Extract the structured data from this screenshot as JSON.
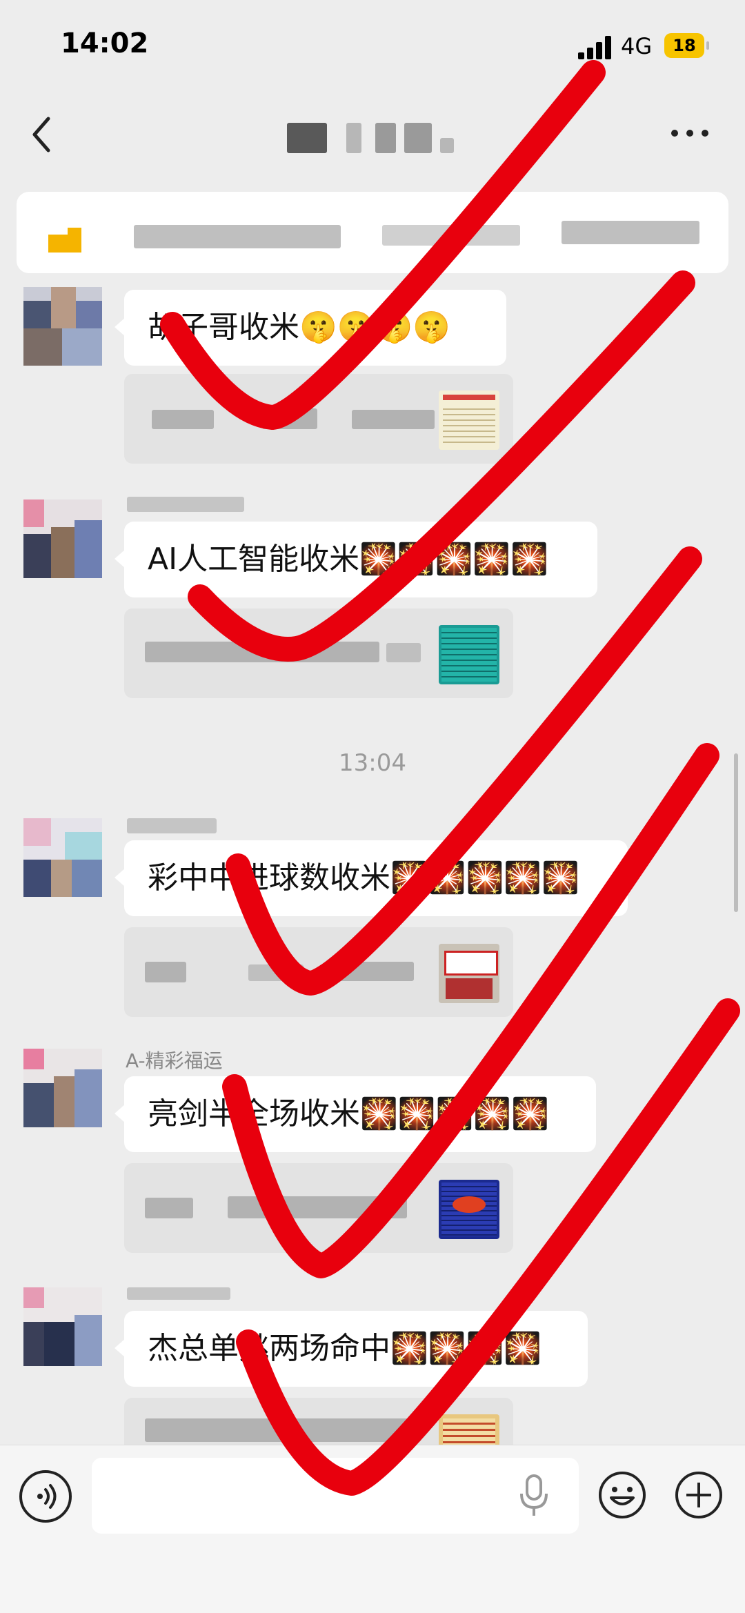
{
  "status_bar": {
    "time": "14:02",
    "network": "4G",
    "battery": "18"
  },
  "nav": {
    "title": "",
    "more_icon": "more-icon",
    "back_icon": "back-icon"
  },
  "messages": [
    {
      "sender": "",
      "text": "胡子哥收米🤫🤫🤫🤫",
      "quote": ""
    },
    {
      "sender": "",
      "text": "AI人工智能收米🎇🎇🎇🎇🎇",
      "quote": ""
    },
    {
      "sender": "",
      "text": "彩中中进球数收米🎇🎇🎇🎇🎇",
      "quote": ""
    },
    {
      "sender": "A-精彩福运",
      "text": "亮剑半全场收米🎇🎇🎇🎇🎇",
      "quote": ""
    },
    {
      "sender": "",
      "text": "杰总单挑两场命中🎇🎇🎇🎇",
      "quote": ""
    }
  ],
  "timestamp": "13:04",
  "input_bar": {
    "voice_icon": "voice-icon",
    "mic_icon": "microphone-icon",
    "emoji_icon": "emoji-icon",
    "plus_icon": "plus-icon"
  },
  "colors": {
    "checkmark": "#e8000d",
    "background": "#ededed",
    "bubble": "#ffffff"
  }
}
